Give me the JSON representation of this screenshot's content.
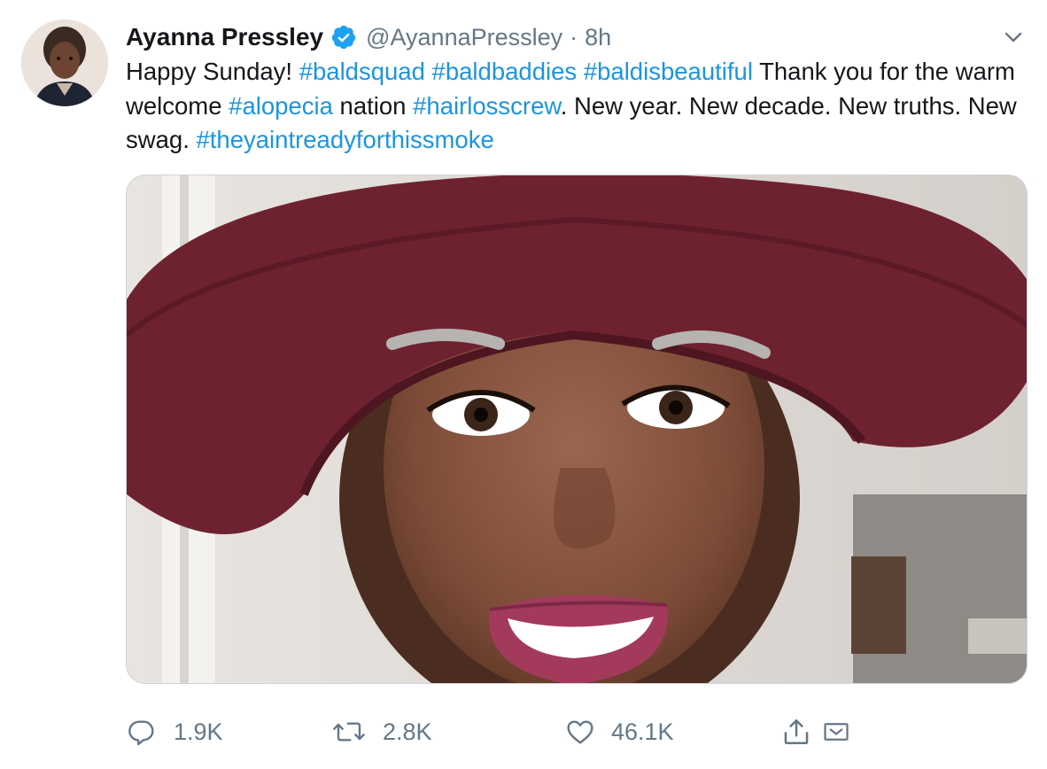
{
  "tweet": {
    "author": {
      "name": "Ayanna Pressley",
      "handle": "@AyannaPressley",
      "verified_icon": "verified-badge-icon",
      "avatar": "profile-avatar"
    },
    "separator": "·",
    "timestamp": "8h",
    "text": {
      "part1": "Happy Sunday! ",
      "tag1": "#baldsquad",
      "space1": " ",
      "tag2": "#baldbaddies",
      "space2": " ",
      "tag3": "#baldisbeautiful",
      "part2": " Thank you for the warm welcome ",
      "tag4": "#alopecia",
      "part3": " nation ",
      "tag5": "#hairlosscrew",
      "part4": ". New year. New decade. New truths. New swag. ",
      "tag6": "#theyaintreadyforthissmoke"
    },
    "media": {
      "type": "photo",
      "description_icon": "selfie-photo"
    },
    "actions": {
      "reply_count": "1.9K",
      "retweet_count": "2.8K",
      "like_count": "46.1K"
    }
  },
  "colors": {
    "link": "#1b95e0",
    "secondary_text": "#657786",
    "verified": "#1da1f2",
    "primary_text": "#14171a"
  },
  "icons": {
    "caret": "chevron-down-icon",
    "reply": "reply-bubble-icon",
    "retweet": "retweet-icon",
    "like": "heart-icon",
    "share": "share-icon",
    "dm": "direct-message-icon"
  }
}
